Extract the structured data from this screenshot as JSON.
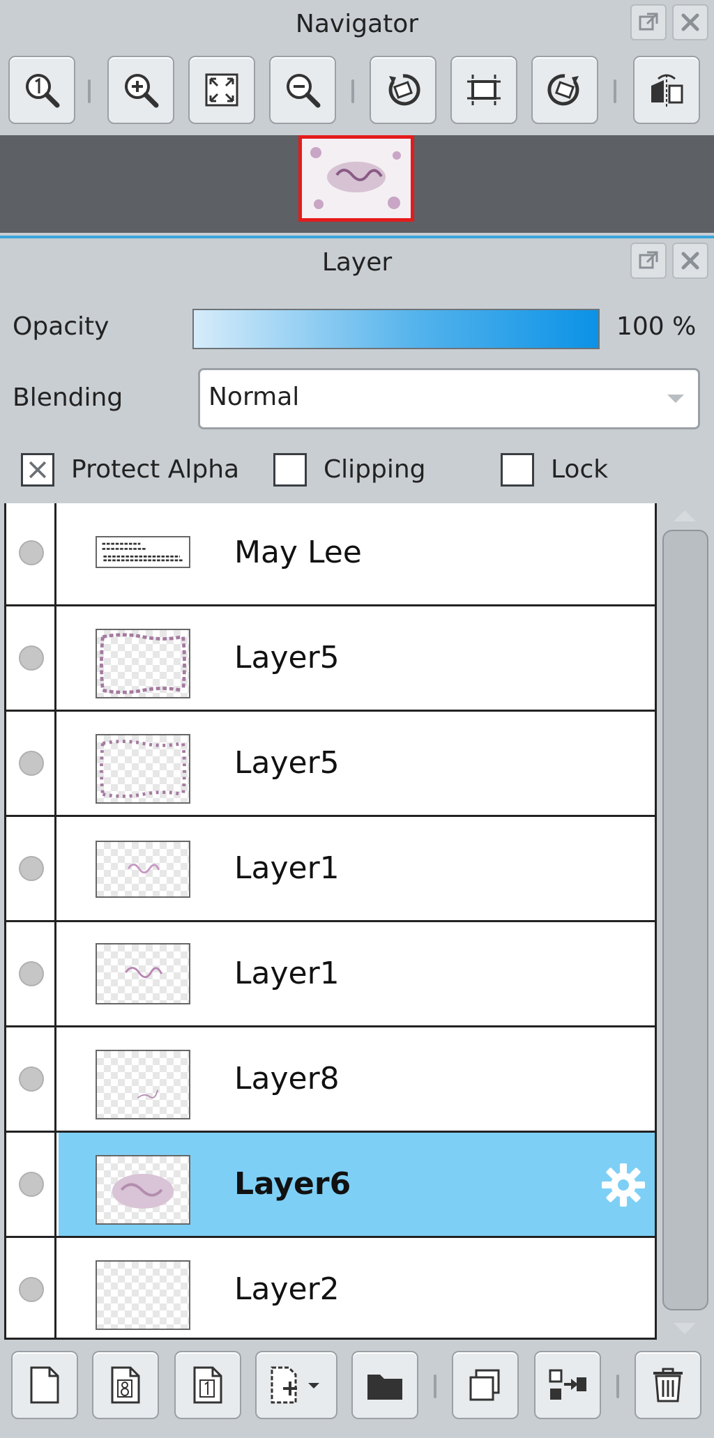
{
  "navigator": {
    "title": "Navigator",
    "tools": [
      {
        "icon": "zoom-actual-size-icon"
      },
      {
        "icon": "zoom-in-icon"
      },
      {
        "icon": "fit-to-window-icon"
      },
      {
        "icon": "zoom-out-icon"
      },
      {
        "icon": "rotate-left-icon"
      },
      {
        "icon": "reset-rotation-icon"
      },
      {
        "icon": "rotate-right-icon"
      },
      {
        "icon": "flip-horizontal-icon"
      }
    ],
    "preview_frame_color": "#e51b1b"
  },
  "layer_panel": {
    "title": "Layer",
    "opacity_label": "Opacity",
    "opacity_value": "100 %",
    "opacity_fraction": 1.0,
    "blending_label": "Blending",
    "blending_value": "Normal",
    "protect_alpha_label": "Protect Alpha",
    "protect_alpha_checked": true,
    "clipping_label": "Clipping",
    "clipping_checked": false,
    "lock_label": "Lock",
    "lock_checked": false,
    "selection_color": "#7ecff5",
    "accent_color": "#3aa6dc",
    "layers": [
      {
        "name": "May Lee",
        "selected": false
      },
      {
        "name": "Layer5",
        "selected": false
      },
      {
        "name": "Layer5",
        "selected": false
      },
      {
        "name": "Layer1",
        "selected": false
      },
      {
        "name": "Layer1",
        "selected": false
      },
      {
        "name": "Layer8",
        "selected": false
      },
      {
        "name": "Layer6",
        "selected": true
      },
      {
        "name": "Layer2",
        "selected": false
      }
    ],
    "bottom_tools": [
      {
        "icon": "new-layer-icon"
      },
      {
        "icon": "new-8bit-layer-icon"
      },
      {
        "icon": "new-1bit-layer-icon"
      },
      {
        "icon": "add-layer-dropdown-icon"
      },
      {
        "icon": "new-folder-icon"
      },
      {
        "icon": "duplicate-layer-icon"
      },
      {
        "icon": "merge-down-icon"
      },
      {
        "icon": "delete-layer-icon"
      }
    ]
  }
}
